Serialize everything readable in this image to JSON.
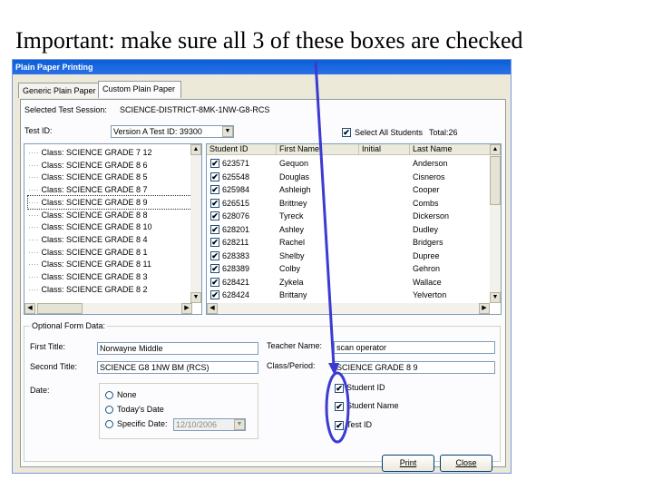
{
  "caption": "Important: make sure all 3 of these boxes are checked",
  "window": {
    "title": "Plain Paper Printing"
  },
  "tabs": [
    {
      "label": "Generic Plain Paper"
    },
    {
      "label": "Custom Plain Paper"
    }
  ],
  "session": {
    "label": "Selected Test Session:",
    "value": "SCIENCE-DISTRICT-8MK-1NW-G8-RCS"
  },
  "test_id": {
    "label": "Test ID:",
    "value": "Version A Test ID: 39300"
  },
  "select_all": {
    "label": "Select All Students",
    "total": "Total:26",
    "checked": true
  },
  "classes": [
    "Class: SCIENCE GRADE 7 12",
    "Class: SCIENCE GRADE 8 6",
    "Class: SCIENCE GRADE 8 5",
    "Class: SCIENCE GRADE 8 7",
    "Class: SCIENCE GRADE 8 9",
    "Class: SCIENCE GRADE 8 8",
    "Class: SCIENCE GRADE 8 10",
    "Class: SCIENCE GRADE 8 4",
    "Class: SCIENCE GRADE 8 1",
    "Class: SCIENCE GRADE 8 11",
    "Class: SCIENCE GRADE 8 3",
    "Class: SCIENCE GRADE 8 2"
  ],
  "student_table": {
    "columns": [
      "Student ID",
      "First Name",
      "Initial",
      "Last Name"
    ],
    "rows": [
      {
        "id": "623571",
        "first": "Gequon",
        "initial": "",
        "last": "Anderson"
      },
      {
        "id": "625548",
        "first": "Douglas",
        "initial": "",
        "last": "Cisneros"
      },
      {
        "id": "625984",
        "first": "Ashleigh",
        "initial": "",
        "last": "Cooper"
      },
      {
        "id": "626515",
        "first": "Brittney",
        "initial": "",
        "last": "Combs"
      },
      {
        "id": "628076",
        "first": "Tyreck",
        "initial": "",
        "last": "Dickerson"
      },
      {
        "id": "628201",
        "first": "Ashley",
        "initial": "",
        "last": "Dudley"
      },
      {
        "id": "628211",
        "first": "Rachel",
        "initial": "",
        "last": "Bridgers"
      },
      {
        "id": "628383",
        "first": "Shelby",
        "initial": "",
        "last": "Dupree"
      },
      {
        "id": "628389",
        "first": "Colby",
        "initial": "",
        "last": "Gehron"
      },
      {
        "id": "628421",
        "first": "Zykela",
        "initial": "",
        "last": "Wallace"
      },
      {
        "id": "628424",
        "first": "Brittany",
        "initial": "",
        "last": "Yelverton"
      }
    ]
  },
  "optional_form": {
    "legend": "Optional Form Data:",
    "first_title": {
      "label": "First Title:",
      "value": "Norwayne Middle"
    },
    "second_title": {
      "label": "Second Title:",
      "value": "SCIENCE G8 1NW BM (RCS)"
    },
    "teacher": {
      "label": "Teacher Name:",
      "value": "scan operator"
    },
    "class_period": {
      "label": "Class/Period:",
      "value": "SCIENCE GRADE 8 9"
    },
    "date": {
      "label": "Date:",
      "options": [
        "None",
        "Today's Date",
        "Specific Date:"
      ],
      "specific_value": "12/10/2006"
    },
    "print_options": [
      {
        "label": "Student ID",
        "checked": true
      },
      {
        "label": "Student Name",
        "checked": true
      },
      {
        "label": "Test ID",
        "checked": true
      }
    ]
  },
  "buttons": {
    "print": "Print",
    "close": "Close"
  },
  "colors": {
    "annotation": "#3b3bd1",
    "titlebar": "#0a5fd7"
  }
}
